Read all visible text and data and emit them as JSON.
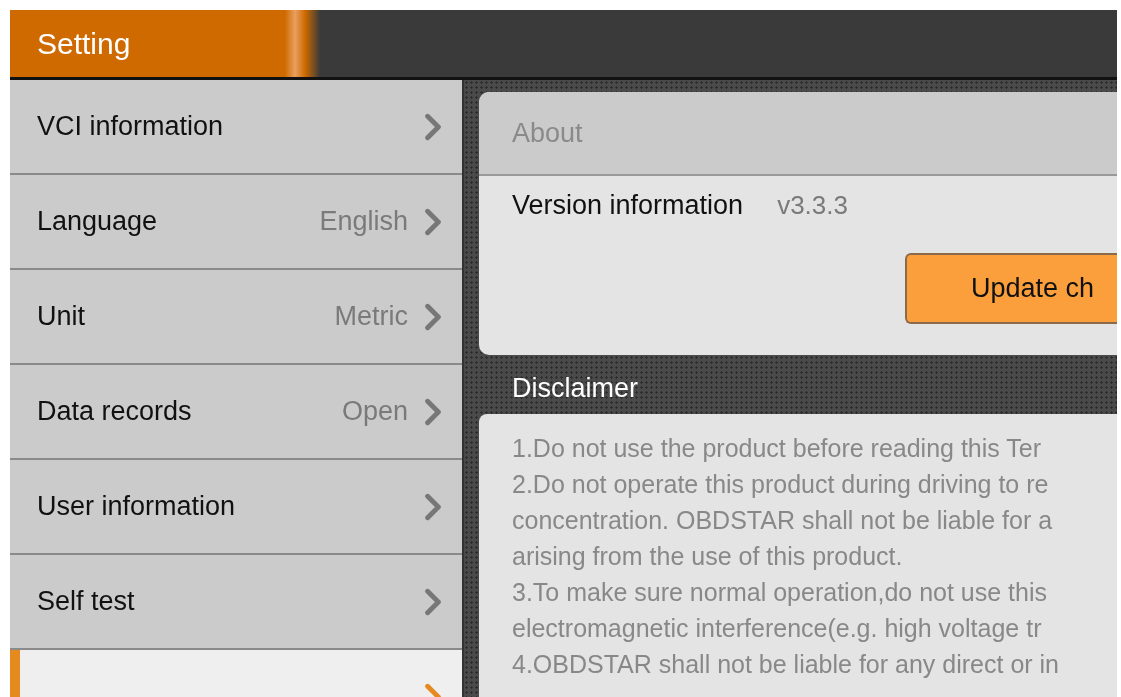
{
  "header": {
    "title": "Setting"
  },
  "sidebar": {
    "items": [
      {
        "label": "VCI information",
        "selected": false
      },
      {
        "label": "Language",
        "value": "English",
        "selected": false
      },
      {
        "label": "Unit",
        "value": "Metric",
        "selected": false
      },
      {
        "label": "Data records",
        "value": "Open",
        "selected": false
      },
      {
        "label": "User information",
        "selected": false
      },
      {
        "label": "Self test",
        "selected": false
      },
      {
        "selected": true
      }
    ]
  },
  "about": {
    "title": "About",
    "version_label": "Version information",
    "version_value": "v3.3.3",
    "update_button": "Update ch"
  },
  "disclaimer": {
    "title": "Disclaimer",
    "lines": [
      "1.Do not use the product before reading this Ter",
      "2.Do not operate this product during driving to re",
      "concentration. OBDSTAR shall not be liable for a",
      "arising from the use of this product.",
      "3.To make sure normal operation,do not use this",
      "electromagnetic interference(e.g. high voltage tr",
      "4.OBDSTAR shall not be liable for any direct or in"
    ]
  }
}
